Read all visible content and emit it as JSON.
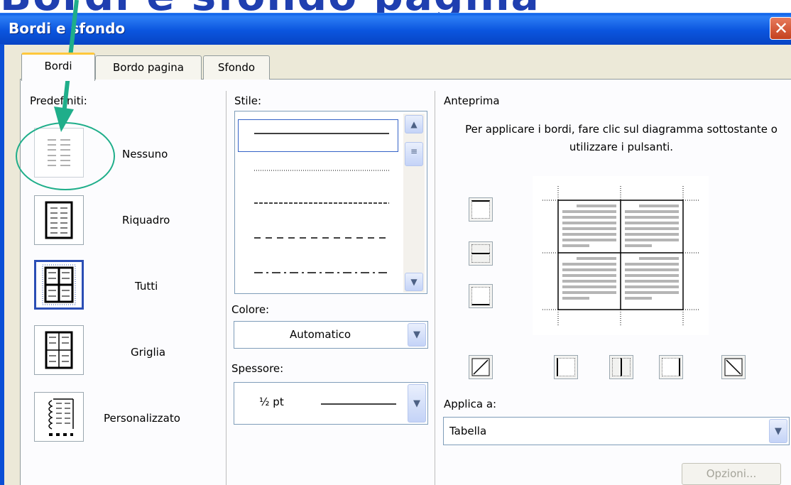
{
  "slide_background_text": "Bordi e sfondo pagina",
  "window": {
    "title": "Bordi e sfondo",
    "close_glyph": "✕"
  },
  "tabs": [
    {
      "label": "Bordi",
      "active": true
    },
    {
      "label": "Bordo pagina",
      "active": false
    },
    {
      "label": "Sfondo",
      "active": false
    }
  ],
  "presets": {
    "heading": "Predefiniti:",
    "items": [
      {
        "label": "Nessuno",
        "icon": "border-none-icon",
        "selected": false
      },
      {
        "label": "Riquadro",
        "icon": "border-box-icon",
        "selected": false
      },
      {
        "label": "Tutti",
        "icon": "border-all-icon",
        "selected": true
      },
      {
        "label": "Griglia",
        "icon": "border-grid-icon",
        "selected": false
      },
      {
        "label": "Personalizzato",
        "icon": "border-custom-icon",
        "selected": false
      }
    ]
  },
  "style": {
    "heading": "Stile:",
    "line_styles": [
      "solid",
      "dotted",
      "dashed-short",
      "dashed-long",
      "dash-dot"
    ],
    "selected_index": 0
  },
  "color": {
    "heading": "Colore:",
    "value": "Automatico"
  },
  "width": {
    "heading": "Spessore:",
    "value": "½ pt"
  },
  "preview": {
    "heading": "Anteprima",
    "instruction": "Per applicare i bordi, fare clic sul diagramma sottostante o utilizzare i pulsanti."
  },
  "apply_to": {
    "heading": "Applica a:",
    "value": "Tabella"
  },
  "options_button": "Opzioni...",
  "colors": {
    "titlebar": "#0b55de",
    "dialog_bg": "#ece9d8",
    "active_tab_accent": "#ffc83c",
    "annotation": "#1fae8a"
  }
}
